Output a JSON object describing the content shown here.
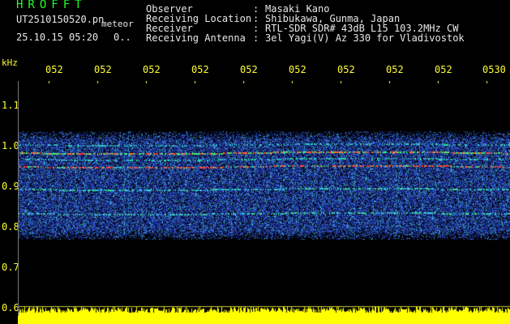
{
  "header": {
    "title": "HROFFT",
    "filename": "UT2510150520.pn",
    "mode": "meteor",
    "datetime": "25.10.15 05:20",
    "extra": "0..",
    "meta": [
      {
        "label": "Observer",
        "value": "Masaki Kano"
      },
      {
        "label": "Receiving Location",
        "value": "Shibukawa, Gunma, Japan"
      },
      {
        "label": "Receiver",
        "value": "RTL-SDR SDR# 43dB L15 103.2MHz CW"
      },
      {
        "label": "Receiving Antenna",
        "value": "3el Yagi(V) Az 330 for Vladivostok"
      }
    ]
  },
  "axis": {
    "unit": "kHz",
    "x_ticks": [
      "052",
      "052",
      "052",
      "052",
      "052",
      "052",
      "052",
      "052",
      "052",
      "0530"
    ],
    "y_ticks": [
      "1.1",
      "1.0",
      "0.9",
      "0.8",
      "0.7",
      "0.6"
    ]
  },
  "colors": {
    "label": "#ffff33",
    "title": "#22ff22",
    "text": "#e8e8e8"
  }
}
